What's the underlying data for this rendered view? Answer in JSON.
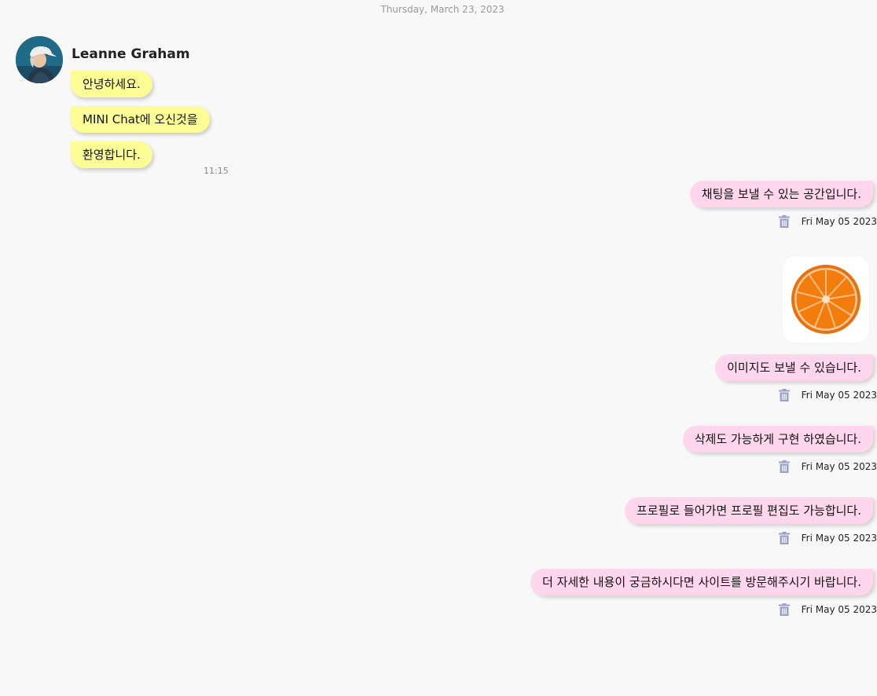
{
  "chat": {
    "date_header": "Thursday, March 23, 2023",
    "sender": {
      "name": "Leanne Graham",
      "avatar": "profile-photo"
    },
    "incoming": [
      {
        "text": "안녕하세요."
      },
      {
        "text": "MINI Chat에 오신것을"
      },
      {
        "text": "환영합니다."
      }
    ],
    "incoming_time": "11:15",
    "outgoing": [
      {
        "text": "채팅을 보낼 수 있는 공간입니다.",
        "date": "Fri May 05 2023"
      },
      {
        "text": "이미지도 보낼 수 있습니다.",
        "date": "Fri May 05 2023"
      },
      {
        "text": "삭제도 가능하게 구현 하였습니다.",
        "date": "Fri May 05 2023"
      },
      {
        "text": "프로필로 들어가면 프로필 편집도 가능합니다.",
        "date": "Fri May 05 2023"
      },
      {
        "text": "더 자세한 내용이 궁금하시다면 사이트를 방문해주시기 바랍니다.",
        "date": "Fri May 05 2023"
      }
    ],
    "image_message": {
      "subject": "orange-slice"
    },
    "colors": {
      "incoming_bubble": "#fdfd96",
      "outgoing_bubble": "#ffd6ec",
      "trash_icon": "#9aa0c8",
      "background": "#f8f8f8"
    },
    "icons": {
      "delete": "trash-icon"
    }
  }
}
